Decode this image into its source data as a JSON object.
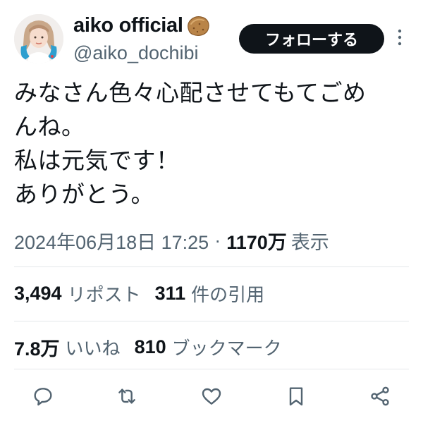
{
  "author": {
    "display_name": "aiko official",
    "handle": "@aiko_dochibi",
    "name_emoji_icon": "potato-icon",
    "avatar_icon": "profile-avatar"
  },
  "follow_button": {
    "label": "フォローする"
  },
  "more_icon": "more-vertical-icon",
  "tweet": {
    "lines": [
      "みなさん色々心配させてもてごめ",
      "んね。",
      "私は元気です！",
      "ありがとう。"
    ]
  },
  "meta": {
    "timestamp": "2024年06月18日 17:25",
    "separator": "·",
    "views_count": "1170万",
    "views_label": "表示"
  },
  "stats": {
    "reposts": {
      "count": "3,494",
      "label": "リポスト"
    },
    "quotes": {
      "count": "311",
      "label": "件の引用"
    },
    "likes": {
      "count": "7.8万",
      "label": "いいね"
    },
    "bookmarks": {
      "count": "810",
      "label": "ブックマーク"
    }
  },
  "actions": [
    "reply-icon",
    "retweet-icon",
    "like-icon",
    "bookmark-icon",
    "share-icon"
  ],
  "colors": {
    "text_primary": "#0f1419",
    "text_secondary": "#536471",
    "divider": "#e4e7ea",
    "button_bg": "#0f1419",
    "button_text": "#ffffff"
  }
}
